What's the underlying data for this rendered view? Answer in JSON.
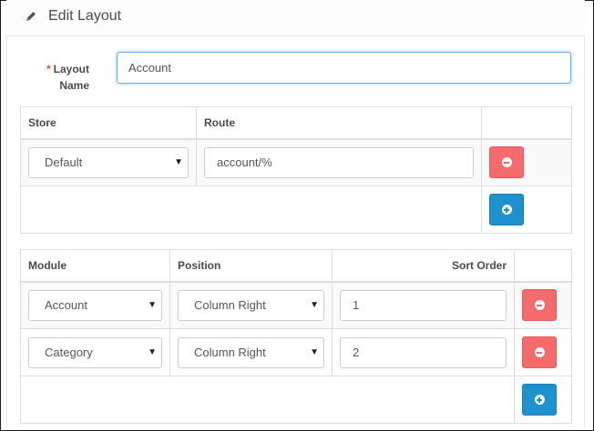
{
  "header": {
    "title": "Edit Layout",
    "icon": "pencil-icon"
  },
  "form": {
    "required_marker": "*",
    "layout_name_label": "Layout Name",
    "layout_name_value": "Account"
  },
  "routes": {
    "headers": {
      "store": "Store",
      "route": "Route"
    },
    "rows": [
      {
        "store": "Default",
        "route": "account/%"
      }
    ]
  },
  "modules": {
    "headers": {
      "module": "Module",
      "position": "Position",
      "sort_order": "Sort Order"
    },
    "rows": [
      {
        "module": "Account",
        "position": "Column Right",
        "sort_order": "1"
      },
      {
        "module": "Category",
        "position": "Column Right",
        "sort_order": "2"
      }
    ]
  },
  "colors": {
    "danger": "#f56b6b",
    "primary": "#1e91cf",
    "required": "#e3503e",
    "focus": "#66afe9"
  },
  "icons": {
    "remove": "minus-circle-icon",
    "add": "plus-circle-icon",
    "dropdown": "caret-down-icon"
  }
}
